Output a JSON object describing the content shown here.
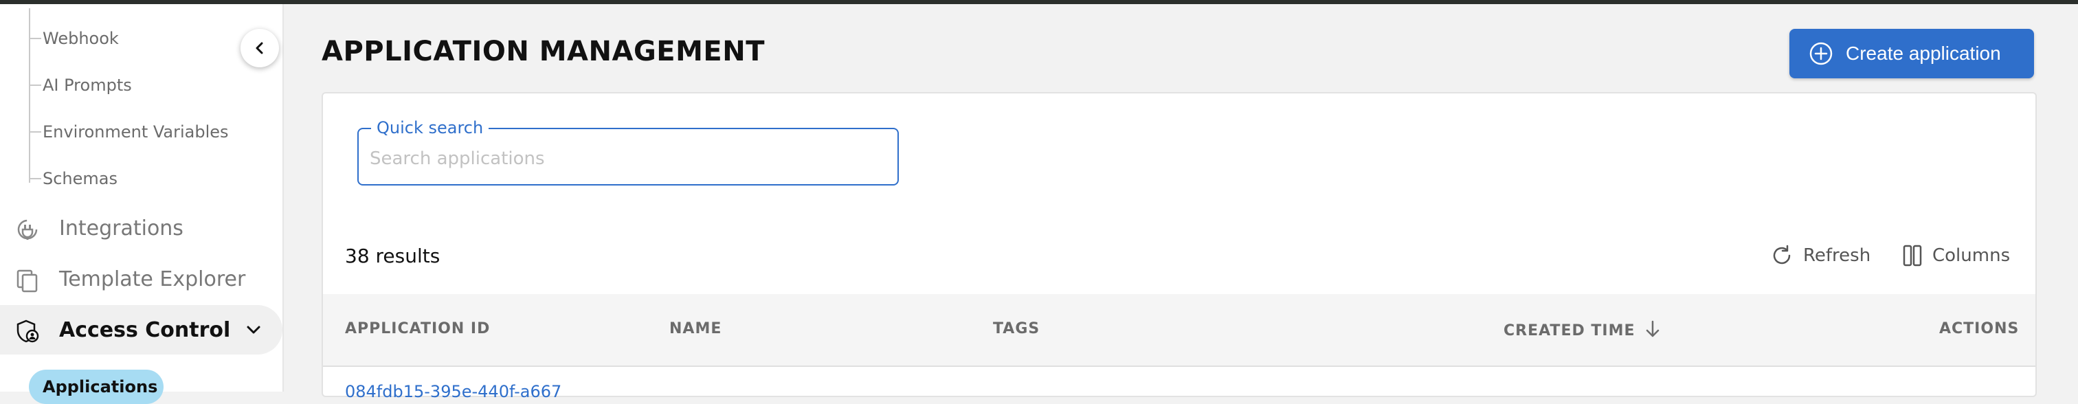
{
  "sidebar": {
    "sub_items": [
      "Webhook",
      "AI Prompts",
      "Environment Variables",
      "Schemas"
    ],
    "nav_items": [
      {
        "label": "Integrations",
        "icon": "integrations-icon"
      },
      {
        "label": "Template Explorer",
        "icon": "copy-icon"
      },
      {
        "label": "Access Control",
        "icon": "shield-user-icon",
        "expanded": true
      }
    ],
    "selected_child": "Applications",
    "collapse_icon": "chevron-left-icon"
  },
  "page": {
    "title": "APPLICATION MANAGEMENT",
    "create_button": "Create application"
  },
  "search": {
    "label": "Quick search",
    "placeholder": "Search applications",
    "value": ""
  },
  "results": {
    "count_text": "38 results",
    "refresh_label": "Refresh",
    "columns_label": "Columns"
  },
  "table": {
    "columns": [
      "APPLICATION ID",
      "NAME",
      "TAGS",
      "CREATED TIME",
      "ACTIONS"
    ],
    "sort_column": "CREATED TIME",
    "sort_direction": "descending",
    "first_row_id_partial": "084fdb15-395e-440f-a667"
  },
  "colors": {
    "accent": "#2f6fcb",
    "selected_pill": "#a7dcf3",
    "top_bar": "#2b2f2c"
  }
}
